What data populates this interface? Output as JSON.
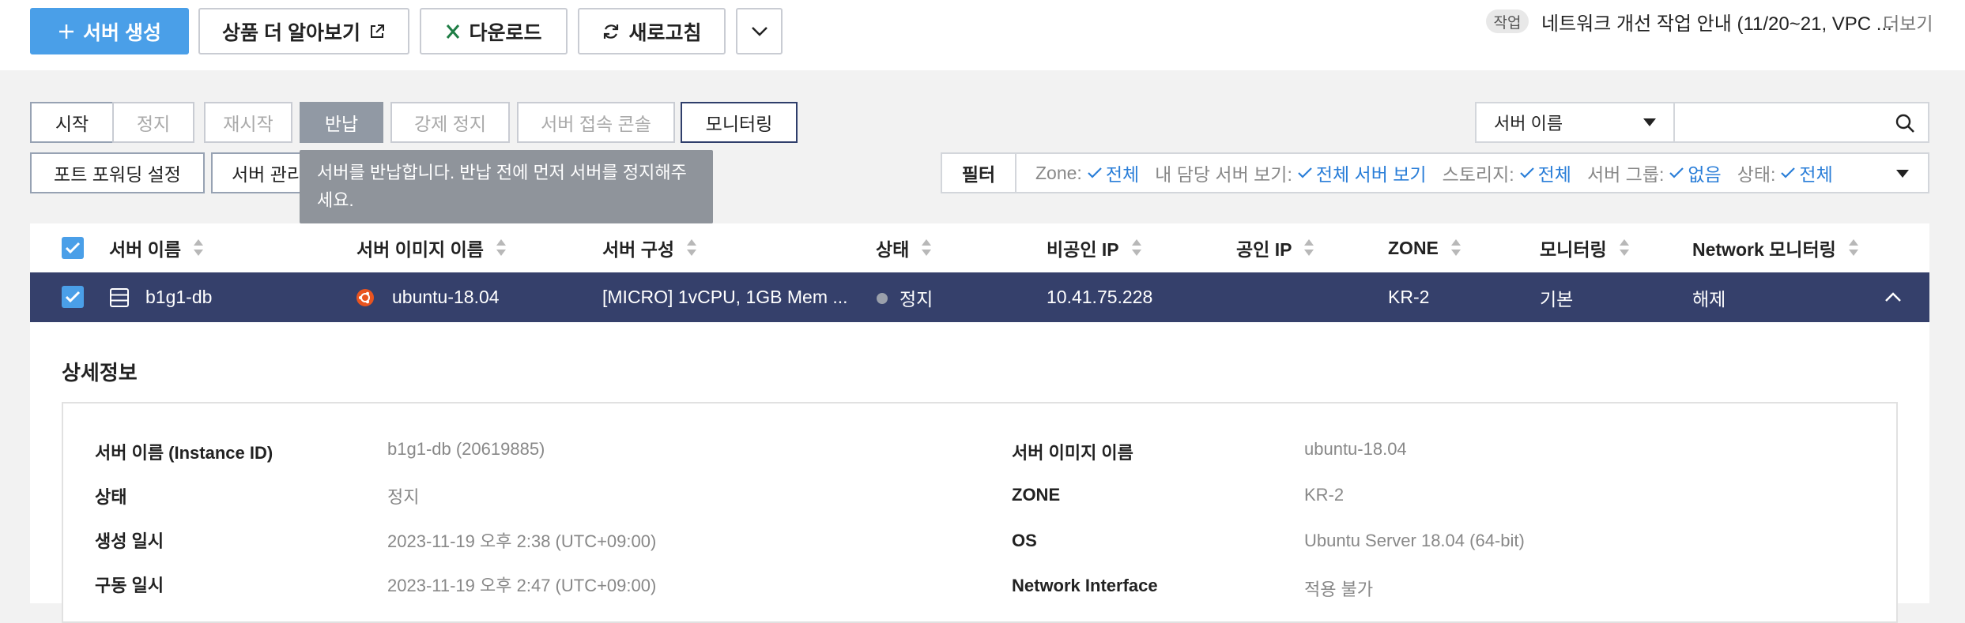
{
  "toolbar": {
    "create_label": "서버 생성",
    "learn_more_label": "상품 더 알아보기",
    "download_label": "다운로드",
    "refresh_label": "새로고침"
  },
  "notice": {
    "label": "작업",
    "text": "네트워크 개선 작업 안내 (11/20~21, VPC ...",
    "more": "더보기"
  },
  "actions": {
    "start": "시작",
    "stop": "정지",
    "restart": "재시작",
    "return": "반납",
    "force_stop": "강제 정지",
    "console": "서버 접속 콘솔",
    "monitoring": "모니터링",
    "port_forwarding": "포트 포워딩 설정",
    "server_manage": "서버 관리"
  },
  "tooltip": {
    "text": "서버를 반납합니다. 반납 전에 먼저 서버를 정지해주세요."
  },
  "search": {
    "select_value": "서버 이름",
    "placeholder": ""
  },
  "filter": {
    "button": "필터",
    "items": [
      {
        "label": "Zone:",
        "value": "전체"
      },
      {
        "label": "내 담당 서버 보기:",
        "value": "전체 서버 보기"
      },
      {
        "label": "스토리지:",
        "value": "전체"
      },
      {
        "label": "서버 그룹:",
        "value": "없음"
      },
      {
        "label": "상태:",
        "value": "전체"
      }
    ]
  },
  "table": {
    "headers": [
      "서버 이름",
      "서버 이미지 이름",
      "서버 구성",
      "상태",
      "비공인 IP",
      "공인 IP",
      "ZONE",
      "모니터링",
      "Network 모니터링"
    ],
    "row": {
      "name": "b1g1-db",
      "image": "ubuntu-18.04",
      "spec": "[MICRO] 1vCPU, 1GB Mem ...",
      "status": "정지",
      "private_ip": "10.41.75.228",
      "public_ip": "",
      "zone": "KR-2",
      "monitoring": "기본",
      "network_monitoring": "해제"
    }
  },
  "detail": {
    "title": "상세정보",
    "left": [
      {
        "key": "서버 이름 (Instance ID)",
        "value": "b1g1-db (20619885)"
      },
      {
        "key": "상태",
        "value": "정지"
      },
      {
        "key": "생성 일시",
        "value": "2023-11-19 오후 2:38 (UTC+09:00)"
      },
      {
        "key": "구동 일시",
        "value": "2023-11-19 오후 2:47 (UTC+09:00)"
      }
    ],
    "right": [
      {
        "key": "서버 이미지 이름",
        "value": "ubuntu-18.04"
      },
      {
        "key": "ZONE",
        "value": "KR-2"
      },
      {
        "key": "OS",
        "value": "Ubuntu Server 18.04 (64-bit)"
      },
      {
        "key": "Network Interface",
        "value": "적용 불가"
      }
    ]
  },
  "colors": {
    "primary": "#4a9fe8",
    "selected_row": "#35406b",
    "filter_value": "#2a7ed8",
    "excel_green": "#1e7d45"
  }
}
